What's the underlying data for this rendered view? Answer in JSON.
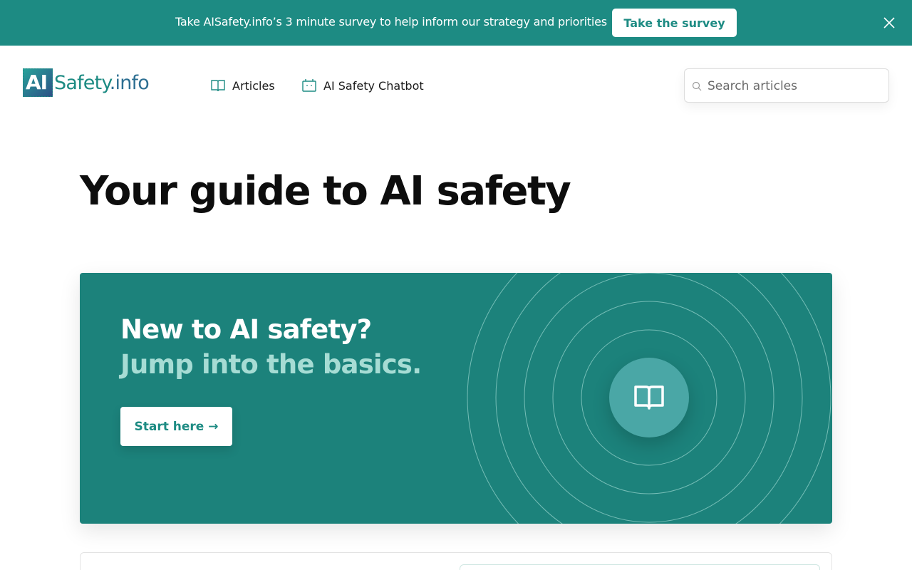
{
  "banner": {
    "text": "Take AISafety.info’s 3 minute survey to help inform our strategy and priorities",
    "button_label": "Take the survey",
    "close_icon": "close-icon"
  },
  "header": {
    "logo": {
      "ai": "AI",
      "safety": "Safety",
      "info": ".info"
    },
    "nav": [
      {
        "label": "Articles",
        "icon": "book-icon"
      },
      {
        "label": "AI Safety Chatbot",
        "icon": "chatbot-icon"
      }
    ],
    "search": {
      "placeholder": "Search articles",
      "icon": "search-icon"
    }
  },
  "main": {
    "title": "Your guide to AI safety",
    "hero": {
      "heading": "New to AI safety?",
      "subheading": "Jump into the basics.",
      "button_label": "Start here →",
      "icon": "open-book-icon"
    }
  },
  "colors": {
    "brand": "#1d8b83",
    "hero_bg": "#1c827b",
    "hero_subheading": "#a6dcd4",
    "hero_icon_bg": "#4aa7a6"
  }
}
